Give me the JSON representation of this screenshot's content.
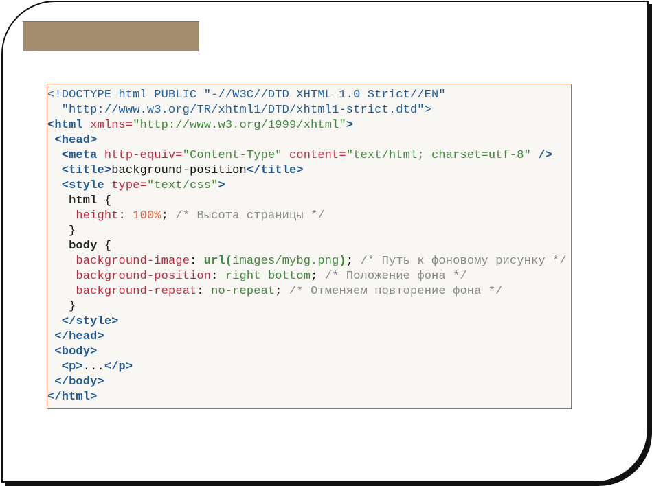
{
  "slide": {
    "title_bar_color": "#a38d6c",
    "code_border_color": "#c8683c"
  },
  "code_lines": [
    [
      [
        "doc",
        "<!DOCTYPE html PUBLIC \"-//W3C//DTD XHTML 1.0 Strict//EN\""
      ]
    ],
    [
      [
        "doc",
        "  \"http://www.w3.org/TR/xhtml1/DTD/xhtml1-strict.dtd\">"
      ]
    ],
    [
      [
        "tag",
        "<html"
      ],
      [
        "txt",
        " "
      ],
      [
        "attr",
        "xmlns="
      ],
      [
        "str",
        "\"http://www.w3.org/1999/xhtml\""
      ],
      [
        "tag",
        ">"
      ]
    ],
    [
      [
        "txt",
        " "
      ],
      [
        "tag",
        "<head>"
      ]
    ],
    [
      [
        "txt",
        "  "
      ],
      [
        "tag",
        "<meta"
      ],
      [
        "txt",
        " "
      ],
      [
        "attr",
        "http-equiv="
      ],
      [
        "str",
        "\"Content-Type\""
      ],
      [
        "txt",
        " "
      ],
      [
        "attr",
        "content="
      ],
      [
        "str",
        "\"text/html; charset=utf-8\""
      ],
      [
        "txt",
        " "
      ],
      [
        "tag",
        "/>"
      ]
    ],
    [
      [
        "txt",
        "  "
      ],
      [
        "tag",
        "<title>"
      ],
      [
        "txt",
        "background-position"
      ],
      [
        "tag",
        "</title>"
      ]
    ],
    [
      [
        "txt",
        "  "
      ],
      [
        "tag",
        "<style"
      ],
      [
        "txt",
        " "
      ],
      [
        "attr",
        "type="
      ],
      [
        "str",
        "\"text/css\""
      ],
      [
        "tag",
        ">"
      ]
    ],
    [
      [
        "txt",
        "   "
      ],
      [
        "sel",
        "html"
      ],
      [
        "txt",
        " {"
      ]
    ],
    [
      [
        "txt",
        "    "
      ],
      [
        "attr",
        "height"
      ],
      [
        "txt",
        ": "
      ],
      [
        "num",
        "100%"
      ],
      [
        "txt",
        "; "
      ],
      [
        "com",
        "/* Высота страницы */"
      ]
    ],
    [
      [
        "txt",
        "   }"
      ]
    ],
    [
      [
        "txt",
        "   "
      ],
      [
        "sel",
        "body"
      ],
      [
        "txt",
        " {"
      ]
    ],
    [
      [
        "txt",
        "    "
      ],
      [
        "attr",
        "background-image"
      ],
      [
        "txt",
        ": "
      ],
      [
        "fn",
        "url("
      ],
      [
        "str",
        "images/mybg.png"
      ],
      [
        "fn",
        ")"
      ],
      [
        "txt",
        "; "
      ],
      [
        "com",
        "/* Путь к фоновому рисунку */"
      ]
    ],
    [
      [
        "txt",
        "    "
      ],
      [
        "attr",
        "background-position"
      ],
      [
        "txt",
        ": "
      ],
      [
        "str",
        "right bottom"
      ],
      [
        "txt",
        "; "
      ],
      [
        "com",
        "/* Положение фона */"
      ]
    ],
    [
      [
        "txt",
        "    "
      ],
      [
        "attr",
        "background-repeat"
      ],
      [
        "txt",
        ": "
      ],
      [
        "str",
        "no-repeat"
      ],
      [
        "txt",
        "; "
      ],
      [
        "com",
        "/* Отменяем повторение фона */"
      ]
    ],
    [
      [
        "txt",
        "   }"
      ]
    ],
    [
      [
        "txt",
        "  "
      ],
      [
        "tag",
        "</style>"
      ]
    ],
    [
      [
        "txt",
        " "
      ],
      [
        "tag",
        "</head>"
      ]
    ],
    [
      [
        "txt",
        " "
      ],
      [
        "tag",
        "<body>"
      ]
    ],
    [
      [
        "txt",
        "  "
      ],
      [
        "tag",
        "<p>"
      ],
      [
        "txt",
        "..."
      ],
      [
        "tag",
        "</p>"
      ]
    ],
    [
      [
        "txt",
        " "
      ],
      [
        "tag",
        "</body>"
      ]
    ],
    [
      [
        "tag",
        "</html>"
      ]
    ]
  ]
}
